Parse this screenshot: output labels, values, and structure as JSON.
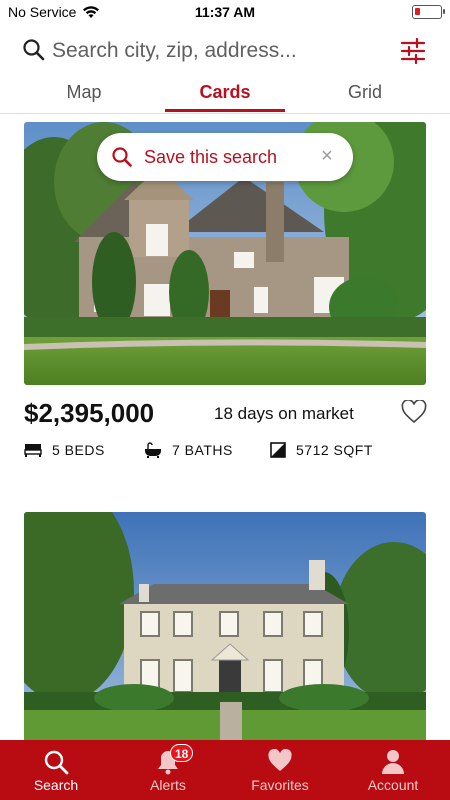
{
  "status_bar": {
    "carrier": "No Service",
    "time": "11:37 AM"
  },
  "search": {
    "placeholder": "Search city, zip, address..."
  },
  "tabs": [
    {
      "label": "Map",
      "active": false
    },
    {
      "label": "Cards",
      "active": true
    },
    {
      "label": "Grid",
      "active": false
    }
  ],
  "save_search": {
    "label": "Save this search",
    "close": "×"
  },
  "listings": [
    {
      "price": "$2,395,000",
      "days_on_market": "18 days on market",
      "beds": "5 BEDS",
      "baths": "7 BATHS",
      "sqft": "5712 SQFT"
    }
  ],
  "bottom_nav": [
    {
      "label": "Search",
      "active": true,
      "icon": "search-icon"
    },
    {
      "label": "Alerts",
      "active": false,
      "icon": "bell-icon",
      "badge": "18"
    },
    {
      "label": "Favorites",
      "active": false,
      "icon": "heart-icon"
    },
    {
      "label": "Account",
      "active": false,
      "icon": "user-icon"
    }
  ],
  "colors": {
    "brand": "#b80c12",
    "accent": "#b8101e"
  }
}
